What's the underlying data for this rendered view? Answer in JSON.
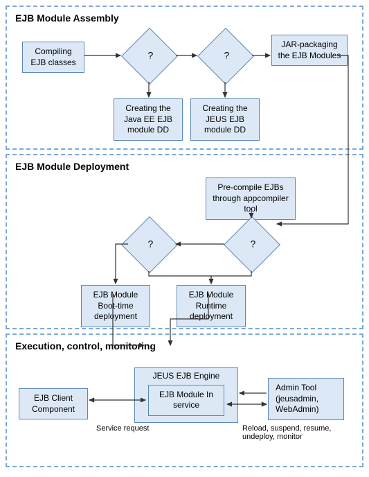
{
  "assembly": {
    "title": "EJB Module Assembly",
    "compile": "Compiling EJB classes",
    "d1": "?",
    "d2": "?",
    "jar": "JAR-packaging the  EJB Modules",
    "dd1": "Creating the Java EE EJB module DD",
    "dd2": "Creating the JEUS EJB module DD"
  },
  "deploy": {
    "title": "EJB Module Deployment",
    "pre": "Pre-compile EJBs through appcompiler tool",
    "d1": "?",
    "d2": "?",
    "boot": "EJB Module Boot-time deployment",
    "run": "EJB Module Runtime deployment"
  },
  "exec": {
    "title": "Execution, control, monitoring",
    "client": "EJB Client Component",
    "engine": "JEUS EJB Engine",
    "svc": "EJB Module In service",
    "admin": "Admin Tool (jeusadmin, WebAdmin)",
    "req": "Service request",
    "ops": "Reload, suspend, resume, undeploy, monitor"
  }
}
